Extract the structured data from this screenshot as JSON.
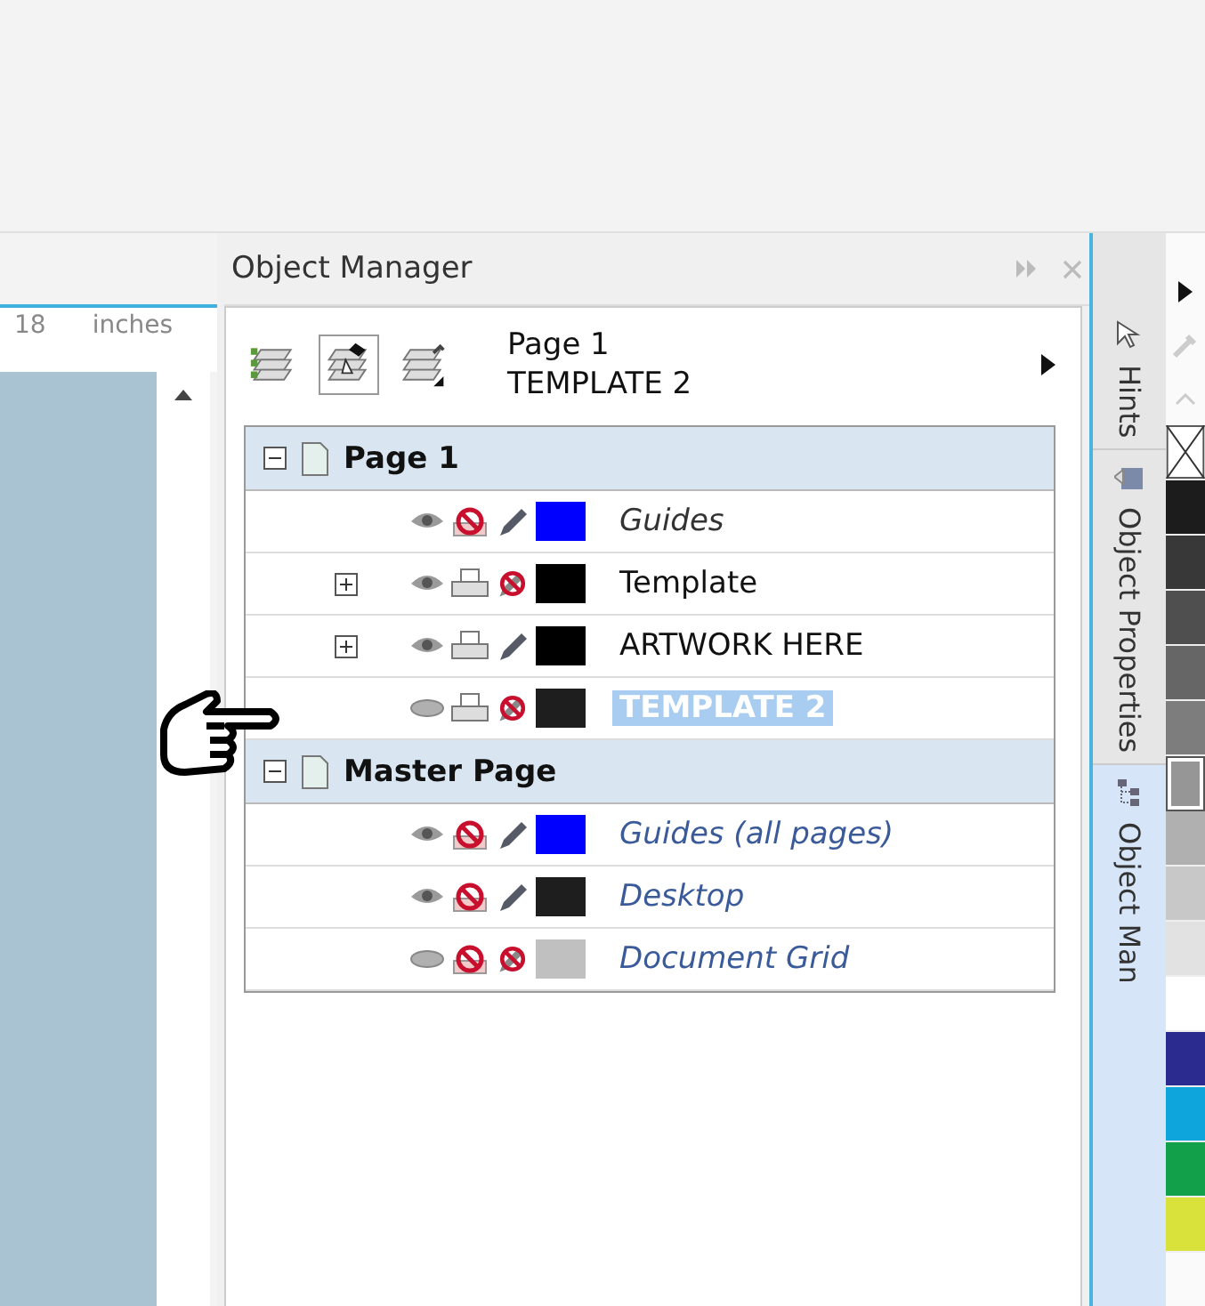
{
  "ruler": {
    "value": "18",
    "unit": "inches"
  },
  "panel": {
    "title": "Object Manager",
    "toolbar": [
      {
        "kind": "checked",
        "selected": false
      },
      {
        "kind": "edit",
        "selected": true
      },
      {
        "kind": "numbered",
        "selected": false
      }
    ],
    "current": {
      "page": "Page 1",
      "layer": "TEMPLATE 2"
    },
    "pages": [
      {
        "name": "Page 1",
        "expanded": true,
        "layers": [
          {
            "kind": "guide",
            "name": "Guides",
            "visible": true,
            "printable": false,
            "editable": true,
            "has_children": false,
            "color": "#0000ff",
            "selected": false
          },
          {
            "kind": "layer",
            "name": "Template",
            "visible": true,
            "printable": true,
            "editable": false,
            "has_children": true,
            "color": "#000000",
            "selected": false
          },
          {
            "kind": "layer",
            "name": "ARTWORK HERE",
            "visible": true,
            "printable": true,
            "editable": true,
            "has_children": true,
            "color": "#000000",
            "selected": false
          },
          {
            "kind": "layer",
            "name": "TEMPLATE 2",
            "visible": false,
            "printable": true,
            "editable": false,
            "has_children": false,
            "color": "#1e1e1e",
            "selected": true
          }
        ]
      },
      {
        "name": "Master Page",
        "expanded": true,
        "layers": [
          {
            "kind": "master",
            "name": "Guides (all pages)",
            "visible": true,
            "printable": false,
            "editable": true,
            "has_children": false,
            "color": "#0000ff",
            "selected": false
          },
          {
            "kind": "master",
            "name": "Desktop",
            "visible": true,
            "printable": false,
            "editable": true,
            "has_children": false,
            "color": "#1e1e1e",
            "selected": false
          },
          {
            "kind": "master",
            "name": "Document Grid",
            "visible": false,
            "printable": false,
            "editable": false,
            "has_children": false,
            "color": "#c0c0c0",
            "selected": false
          }
        ]
      }
    ]
  },
  "docker_tabs": [
    {
      "label": "Hints",
      "selected": false
    },
    {
      "label": "Object Properties",
      "selected": false
    },
    {
      "label": "Object Man",
      "selected": true
    }
  ],
  "palette": [
    {
      "kind": "none"
    },
    {
      "kind": "color",
      "color": "#1c1c1c",
      "selected": false
    },
    {
      "kind": "color",
      "color": "#383838",
      "selected": false
    },
    {
      "kind": "color",
      "color": "#4f4f4f",
      "selected": false
    },
    {
      "kind": "color",
      "color": "#666666",
      "selected": false
    },
    {
      "kind": "color",
      "color": "#7d7d7d",
      "selected": false
    },
    {
      "kind": "color",
      "color": "#969696",
      "selected": true
    },
    {
      "kind": "color",
      "color": "#b0b0b0",
      "selected": false
    },
    {
      "kind": "color",
      "color": "#c8c8c8",
      "selected": false
    },
    {
      "kind": "color",
      "color": "#e2e2e2",
      "selected": false
    },
    {
      "kind": "color",
      "color": "#ffffff",
      "selected": false
    },
    {
      "kind": "color",
      "color": "#2b2b8f",
      "selected": false
    },
    {
      "kind": "color",
      "color": "#0ea5dd",
      "selected": false
    },
    {
      "kind": "color",
      "color": "#12a04a",
      "selected": false
    },
    {
      "kind": "color",
      "color": "#d9e23a",
      "selected": false
    }
  ]
}
